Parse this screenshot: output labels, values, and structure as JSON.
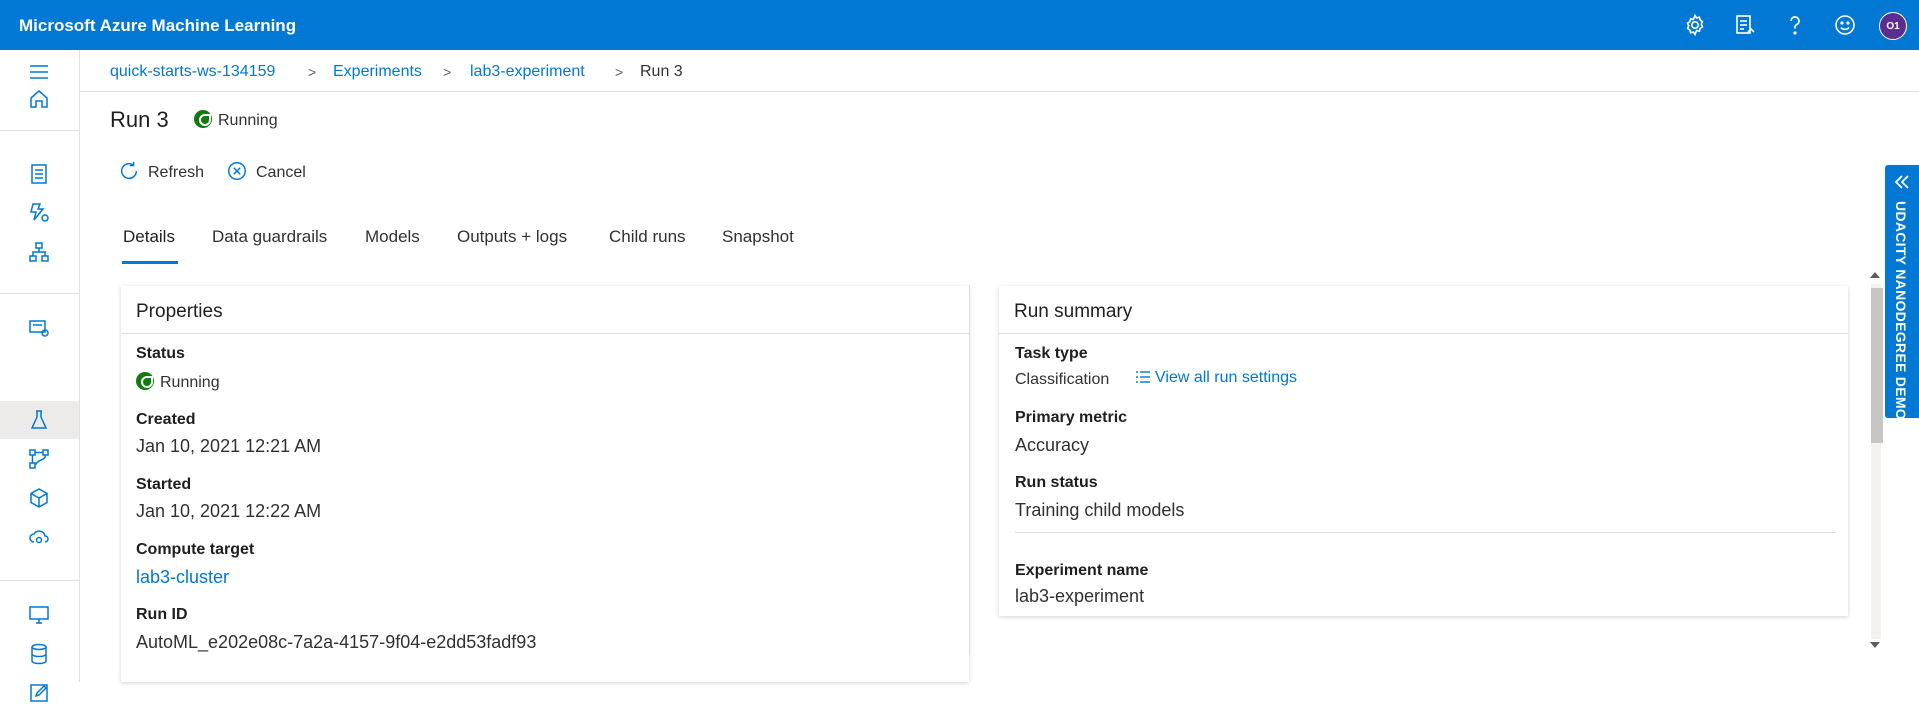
{
  "app": {
    "title": "Microsoft Azure Machine Learning",
    "avatar_initials": "O1"
  },
  "topbar_icons": [
    "gear-icon",
    "feedback-list-icon",
    "help-icon",
    "smiley-icon"
  ],
  "breadcrumb": {
    "items": [
      "quick-starts-ws-134159",
      "Experiments",
      "lab3-experiment",
      "Run 3"
    ],
    "separator": ">"
  },
  "run": {
    "title": "Run 3",
    "status": "Running"
  },
  "commands": {
    "refresh": "Refresh",
    "cancel": "Cancel"
  },
  "tabs": [
    "Details",
    "Data guardrails",
    "Models",
    "Outputs + logs",
    "Child runs",
    "Snapshot"
  ],
  "properties": {
    "title": "Properties",
    "status_label": "Status",
    "status_value": "Running",
    "created_label": "Created",
    "created_value": "Jan 10, 2021 12:21 AM",
    "started_label": "Started",
    "started_value": "Jan 10, 2021 12:22 AM",
    "compute_label": "Compute target",
    "compute_value": "lab3-cluster",
    "runid_label": "Run ID",
    "runid_value": "AutoML_e202e08c-7a2a-4157-9f04-e2dd53fadf93"
  },
  "summary": {
    "title": "Run summary",
    "task_label": "Task type",
    "task_value": "Classification",
    "settings_link": "View all run settings",
    "metric_label": "Primary metric",
    "metric_value": "Accuracy",
    "runstatus_label": "Run status",
    "runstatus_value": "Training child models",
    "expname_label": "Experiment name",
    "expname_value": "lab3-experiment"
  },
  "side_panel": {
    "label": "UDACITY NANODEGREE DEMO"
  },
  "colors": {
    "brand": "#0078d4",
    "running": "#107c10",
    "text": "#323130"
  }
}
